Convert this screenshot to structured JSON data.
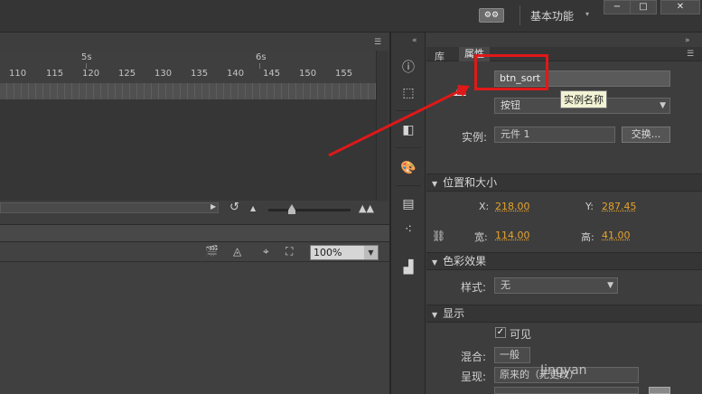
{
  "title_bar": {
    "sync_icon": "sync-settings-icon",
    "workspace_label": "基本功能",
    "workspace_arrow": "▾",
    "window_buttons": [
      "−",
      "□",
      "✕"
    ]
  },
  "timeline": {
    "frame_markers": [
      "5s",
      "6s"
    ],
    "frame_numbers": [
      "110",
      "115",
      "120",
      "125",
      "130",
      "135",
      "140",
      "145",
      "150",
      "155"
    ]
  },
  "stage_toolbar": {
    "zoom_value": "100%"
  },
  "properties_panel": {
    "tabs": [
      "库",
      "属性"
    ],
    "active_tab": "属性",
    "instance_name": "btn_sort",
    "tooltip": "实例名称",
    "symbol_type": "按钮",
    "instance_label": "实例:",
    "instance_of": "元件 1",
    "swap_label": "交换...",
    "sections": {
      "position_size": "位置和大小",
      "color_effect": "色彩效果",
      "display": "显示"
    },
    "x_label": "X:",
    "x_value": "218.00",
    "y_label": "Y:",
    "y_value": "287.45",
    "width_label": "宽:",
    "width_value": "114.00",
    "height_label": "高:",
    "height_value": "41.00",
    "style_label": "样式:",
    "style_value": "无",
    "visible_label": "可见",
    "visible_checked": true,
    "blend_label": "混合:",
    "blend_value": "一般",
    "render_label": "呈现:",
    "render_value": "原来的（无更改）"
  },
  "watermark": "Jingyan",
  "colors": {
    "accent_value": "#e6a32b",
    "annotation_red": "#e01818"
  }
}
